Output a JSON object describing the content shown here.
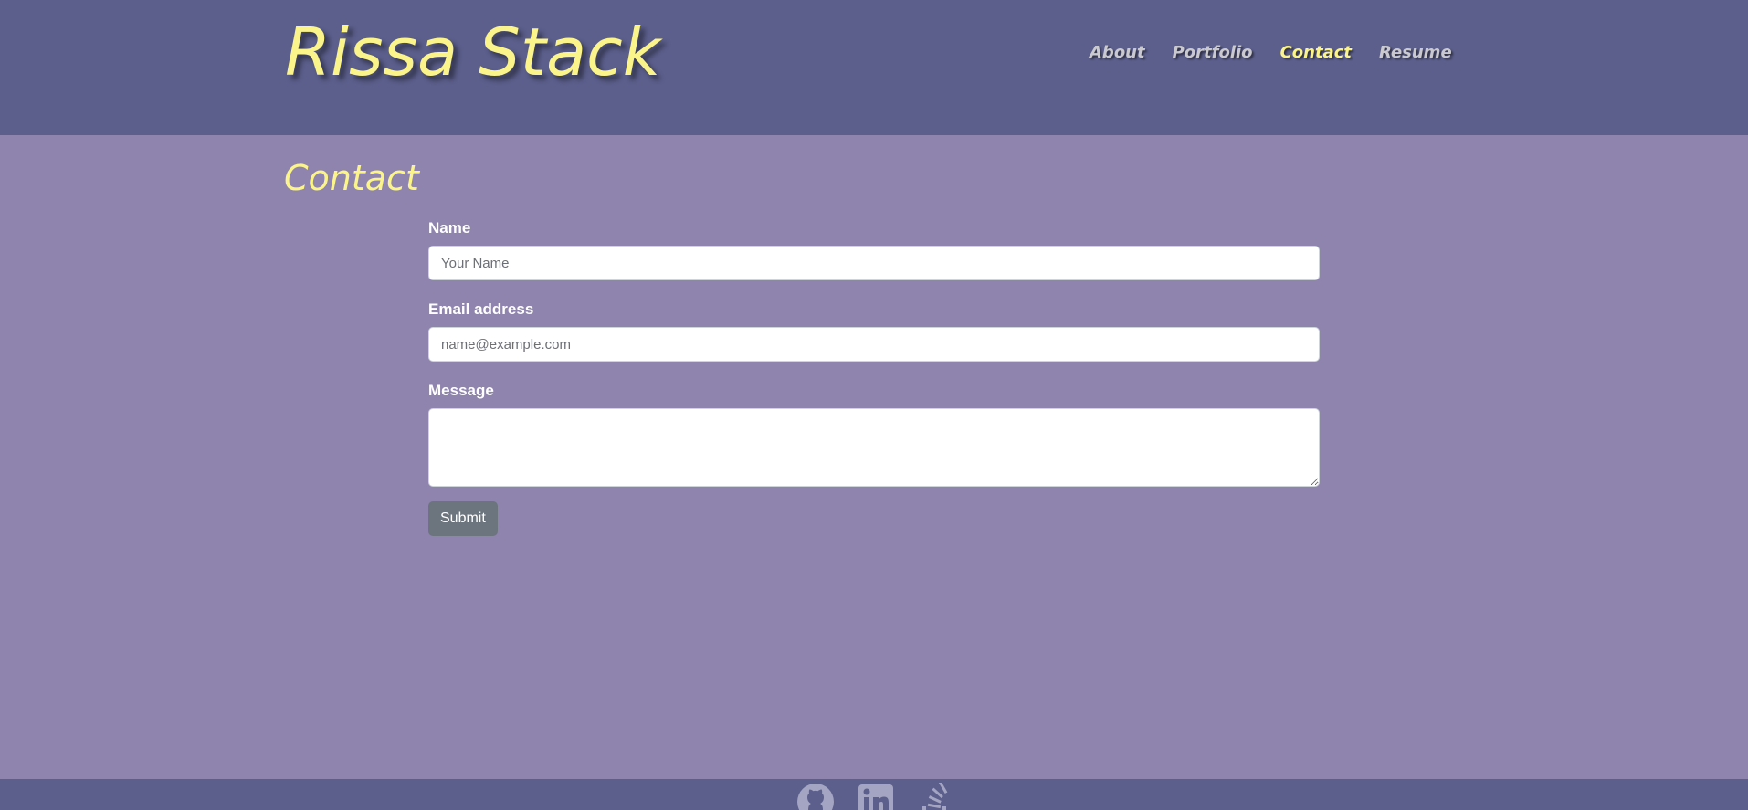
{
  "header": {
    "brand": "Rissa Stack",
    "nav": [
      "About",
      "Portfolio",
      "Contact",
      "Resume"
    ],
    "active": "Contact"
  },
  "main": {
    "title": "Contact",
    "form": {
      "name_label": "Name",
      "name_placeholder": "Your Name",
      "email_label": "Email address",
      "email_placeholder": "name@example.com",
      "message_label": "Message",
      "submit_label": "Submit"
    }
  },
  "footer": {
    "icons": [
      "github-icon",
      "linkedin-icon",
      "stackoverflow-icon"
    ]
  },
  "colors": {
    "header_bg": "#5c5f8c",
    "page_bg": "#8f84ae",
    "accent": "#fbf48a",
    "nav_text": "#c9c9cf",
    "button_bg": "#6c757d"
  }
}
